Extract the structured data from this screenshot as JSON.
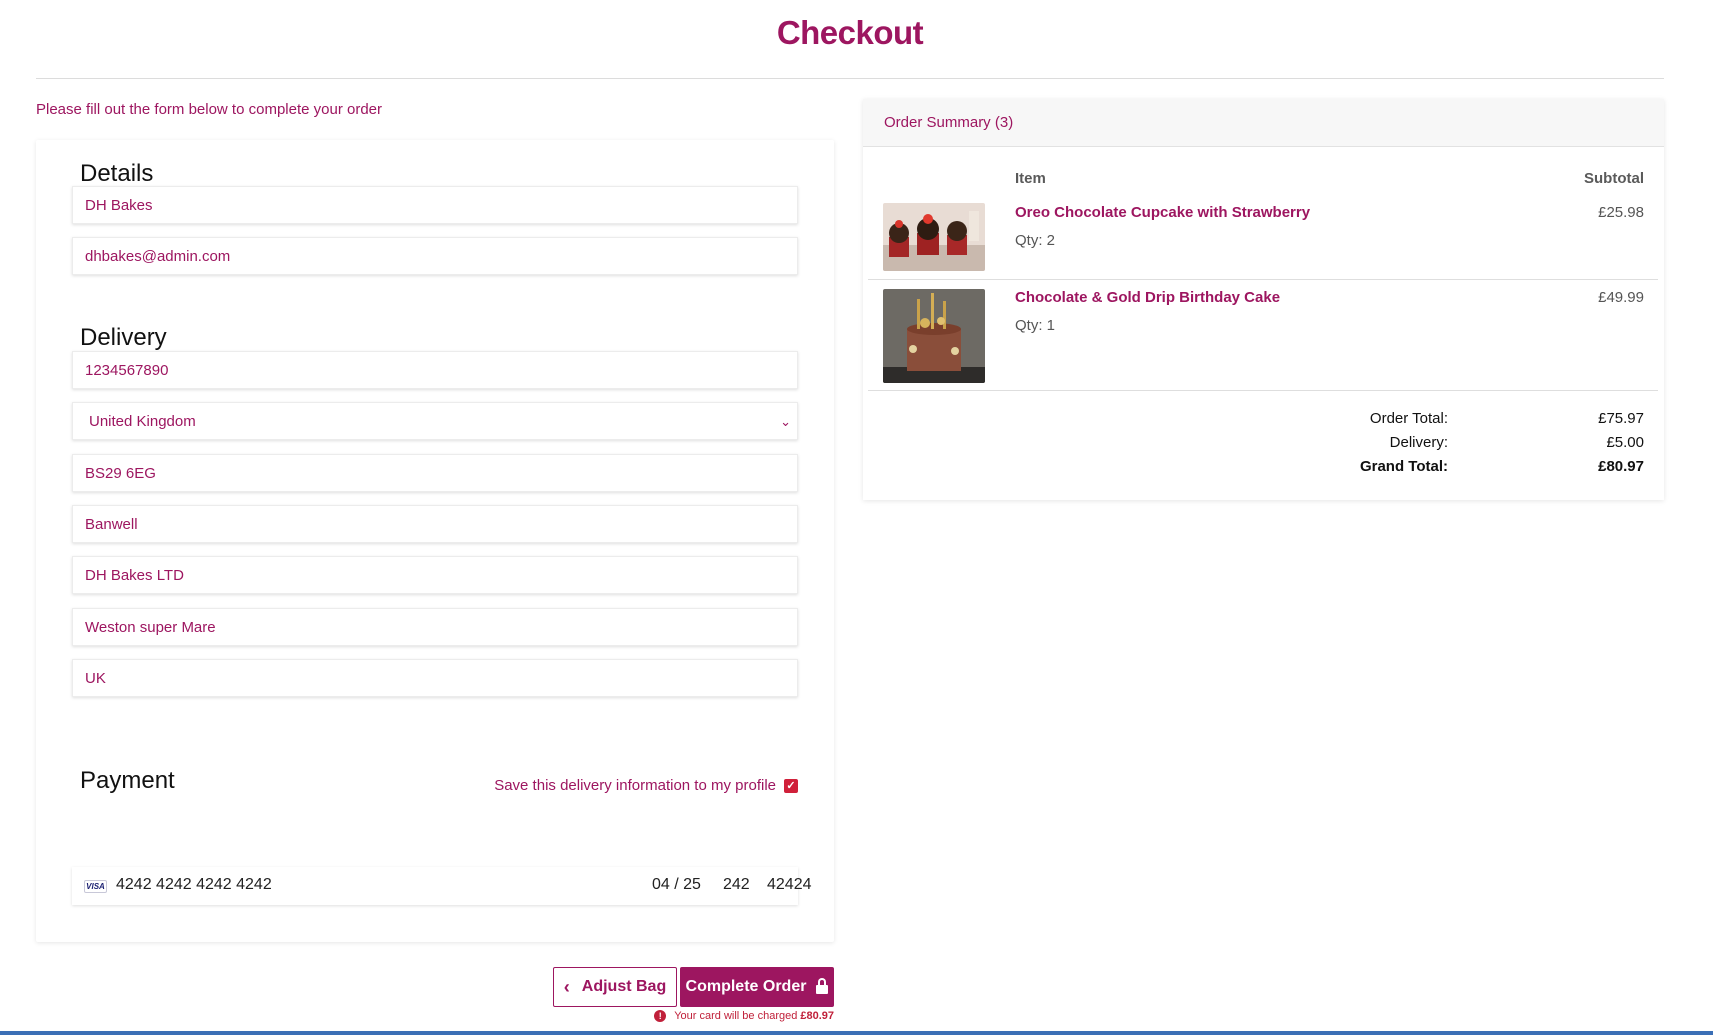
{
  "header": {
    "title": "Checkout"
  },
  "intro": "Please fill out the form below to complete your order",
  "details": {
    "heading": "Details",
    "full_name": "DH Bakes",
    "email": "dhbakes@admin.com"
  },
  "delivery": {
    "heading": "Delivery",
    "phone": "1234567890",
    "country": "United Kingdom",
    "postcode": "BS29 6EG",
    "town": "Banwell",
    "street1": "DH Bakes LTD",
    "street2": "Weston super Mare",
    "county": "UK",
    "save_label": "Save this delivery information to my profile",
    "save_checked": true
  },
  "payment": {
    "heading": "Payment",
    "card_brand": "VISA",
    "card_number": "4242 4242 4242 4242",
    "expiry": "04 / 25",
    "cvc": "242",
    "zip": "42424"
  },
  "actions": {
    "adjust_label": "Adjust Bag",
    "complete_label": "Complete Order",
    "charge_note": "Your card will be charged",
    "charge_amount": "£80.97"
  },
  "summary": {
    "heading": "Order Summary (3)",
    "col_item": "Item",
    "col_subtotal": "Subtotal",
    "items": [
      {
        "name": "Oreo Chocolate Cupcake with Strawberry",
        "qty": "Qty: 2",
        "subtotal": "£25.98"
      },
      {
        "name": "Chocolate & Gold Drip Birthday Cake",
        "qty": "Qty: 1",
        "subtotal": "£49.99"
      }
    ],
    "order_total_label": "Order Total:",
    "order_total": "£75.97",
    "delivery_label": "Delivery:",
    "delivery": "£5.00",
    "grand_total_label": "Grand Total:",
    "grand_total": "£80.97"
  },
  "colors": {
    "brand": "#9d1660",
    "error": "#c0203a",
    "checkbox": "#d0203a"
  },
  "icons": {
    "select": "chevron-down-icon",
    "back": "chevron-left-icon",
    "lock": "lock-icon",
    "warning": "exclamation-circle-icon"
  }
}
